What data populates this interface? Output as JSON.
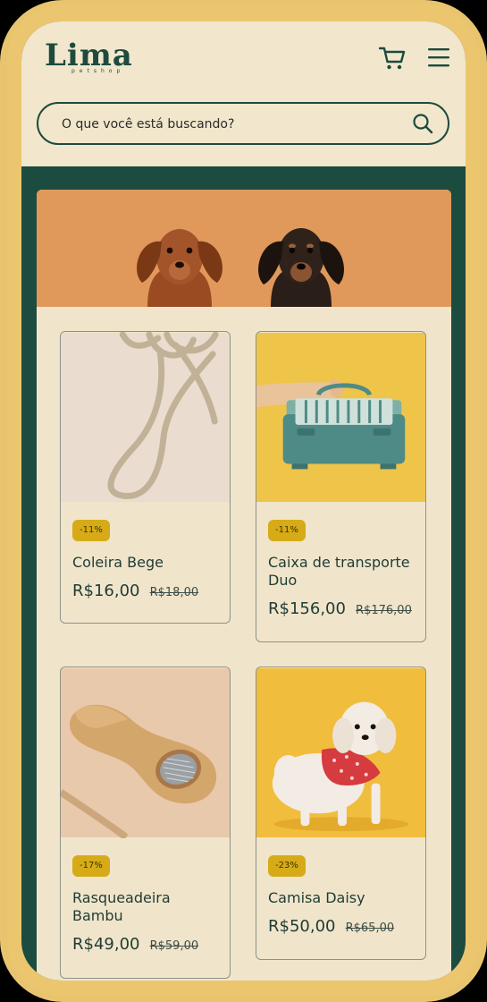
{
  "brand": {
    "name": "Lima",
    "sub": "petshop"
  },
  "search": {
    "placeholder": "O que você está buscando?"
  },
  "icons": {
    "cart": "cart-icon",
    "menu": "menu-icon",
    "search": "search-icon"
  },
  "colors": {
    "green": "#1c4b3f",
    "cream": "#f2e7cc",
    "badge": "#d6ab17",
    "frame": "#e9c46f"
  },
  "products": [
    {
      "discount": "-11%",
      "name": "Coleira Bege",
      "price": "R$16,00",
      "old_price": "R$18,00"
    },
    {
      "discount": "-11%",
      "name": "Caixa de transporte Duo",
      "price": "R$156,00",
      "old_price": "R$176,00"
    },
    {
      "discount": "-17%",
      "name": "Rasqueadeira Bambu",
      "price": "R$49,00",
      "old_price": "R$59,00"
    },
    {
      "discount": "-23%",
      "name": "Camisa Daisy",
      "price": "R$50,00",
      "old_price": "R$65,00"
    }
  ]
}
